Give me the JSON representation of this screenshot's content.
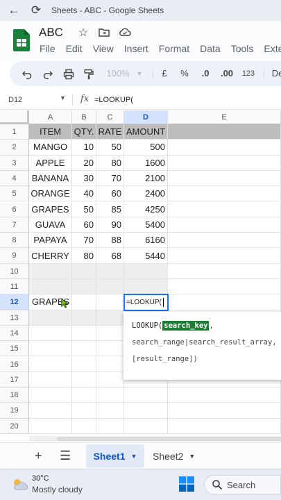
{
  "browser": {
    "title": "Sheets - ABC - Google Sheets"
  },
  "doc": {
    "title": "ABC",
    "menu": [
      "File",
      "Edit",
      "View",
      "Insert",
      "Format",
      "Data",
      "Tools",
      "Exter"
    ]
  },
  "toolbar": {
    "zoom": "100%",
    "currency": "£",
    "percent": "%",
    "dec_decrease": ".0",
    "dec_increase": ".00",
    "number_format": "123",
    "font_truncated": "De"
  },
  "formula_bar": {
    "name_box": "D12",
    "fx": "fx",
    "formula": "=LOOKUP("
  },
  "columns": [
    "A",
    "B",
    "C",
    "D",
    "E"
  ],
  "rows": [
    "1",
    "2",
    "3",
    "4",
    "5",
    "6",
    "7",
    "8",
    "9",
    "10",
    "11",
    "12",
    "13",
    "14",
    "15",
    "16",
    "17",
    "18",
    "19",
    "20"
  ],
  "table": {
    "headers": [
      "ITEM",
      "QTY.",
      "RATE",
      "AMOUNT"
    ],
    "rows": [
      [
        "MANGO",
        "10",
        "50",
        "500"
      ],
      [
        "APPLE",
        "20",
        "80",
        "1600"
      ],
      [
        "BANANA",
        "30",
        "70",
        "2100"
      ],
      [
        "ORANGE",
        "40",
        "60",
        "2400"
      ],
      [
        "GRAPES",
        "50",
        "85",
        "4250"
      ],
      [
        "GUAVA",
        "60",
        "90",
        "5400"
      ],
      [
        "PAPAYA",
        "70",
        "88",
        "6160"
      ],
      [
        "CHERRY",
        "80",
        "68",
        "5440"
      ]
    ]
  },
  "lookup_input": {
    "value": "GRAPES"
  },
  "active_cell": {
    "ref": "D12",
    "text": "=LOOKUP("
  },
  "autocomplete": {
    "fn": "LOOKUP(",
    "highlight": "search_key",
    "rest1": ",",
    "line2": "search_range|search_result_array,",
    "line3": "[result_range])"
  },
  "sheets": {
    "tabs": [
      "Sheet1",
      "Sheet2"
    ],
    "active": "Sheet1"
  },
  "taskbar": {
    "temperature": "30°C",
    "weather": "Mostly cloudy",
    "search_label": "Search"
  },
  "colors": {
    "accent": "#1a73e8",
    "header_fill": "#bdbdbd",
    "highlight_green": "#1e7e34",
    "sheets_green": "#188038"
  },
  "icons": [
    "back-arrow-icon",
    "reload-icon",
    "star-icon",
    "move-folder-icon",
    "cloud-saved-icon",
    "undo-icon",
    "redo-icon",
    "print-icon",
    "paint-format-icon",
    "caret-down-icon",
    "add-sheet-icon",
    "all-sheets-icon",
    "weather-icon",
    "windows-icon",
    "search-icon"
  ]
}
